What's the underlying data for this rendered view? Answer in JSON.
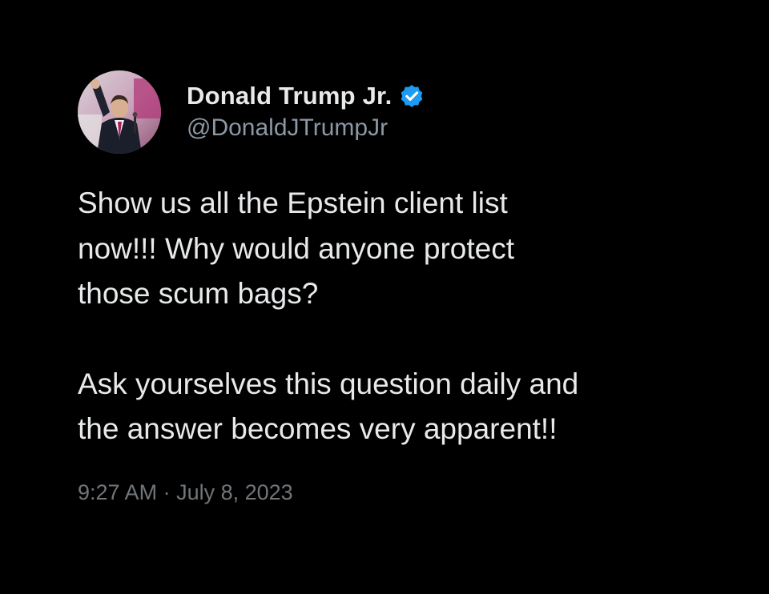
{
  "tweet": {
    "author": {
      "display_name": "Donald Trump Jr.",
      "handle": "@DonaldJTrumpJr",
      "avatar_icon": "profile-photo-icon",
      "verified_icon": "verified-badge-icon",
      "verified_color": "#1d9bf0"
    },
    "paragraphs": [
      "Show us all the Epstein client list\nnow!!! Why would anyone protect\nthose scum bags?",
      "Ask yourselves this question daily and\nthe answer becomes very apparent!!"
    ],
    "time": "9:27 AM",
    "separator": "·",
    "date": "July 8, 2023"
  },
  "colors": {
    "background": "#000000",
    "primary_text": "#e7e9ea",
    "secondary_text": "#71767b"
  }
}
